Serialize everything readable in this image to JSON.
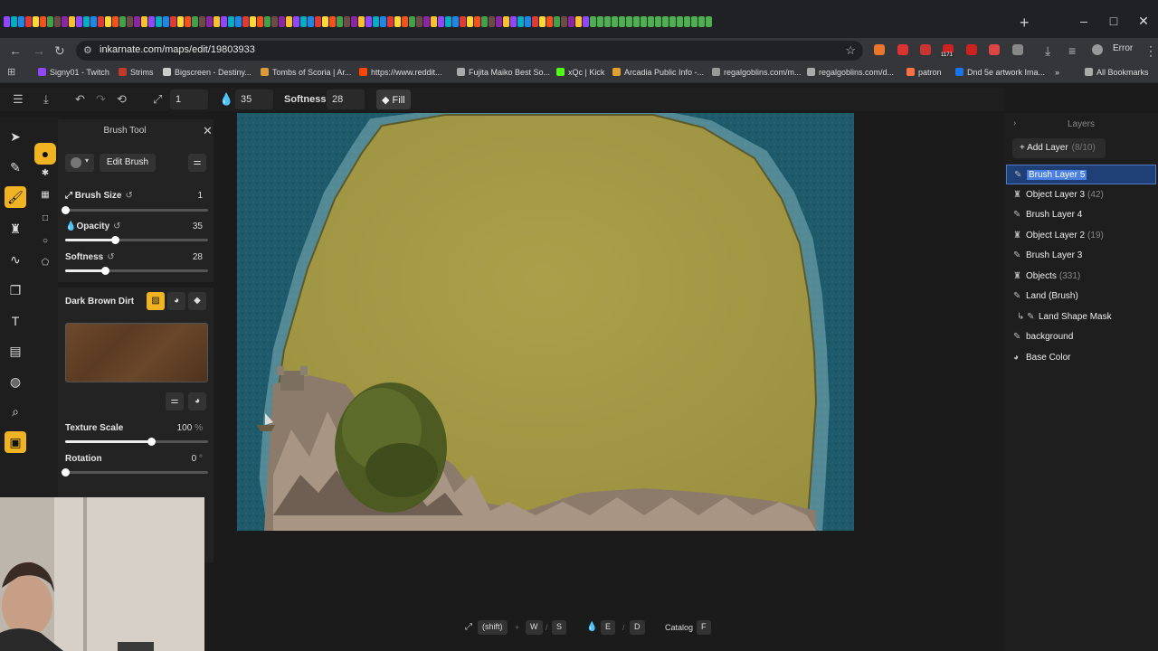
{
  "browser": {
    "url": "inkarnate.com/maps/edit/19803933",
    "error_label": "Error",
    "ext_badge": "1171",
    "bookmarks": [
      "Signy01 - Twitch",
      "Strims",
      "Bigscreen - Destiny...",
      "Tombs of Scoria | Ar...",
      "https://www.reddit...",
      "Fujita Maiko Best So...",
      "xQc | Kick",
      "Arcadia Public Info -...",
      "regalgoblins.com/m...",
      "regalgoblins.com/d...",
      "patron",
      "Dnd 5e artwork Ima..."
    ],
    "all_bookmarks": "All Bookmarks",
    "bookmark_colors": [
      "#9146ff",
      "#c0392b",
      "#cccccc",
      "#d99a3a",
      "#ff4500",
      "#aaaaaa",
      "#53fc18",
      "#e0a030",
      "#999999",
      "#aaaaaa",
      "#ff7043",
      "#1a73e8"
    ]
  },
  "toolbar": {
    "brush_size": "1",
    "opacity": "35",
    "softness_label": "Softness:",
    "softness": "28",
    "fill_label": "Fill"
  },
  "brush_panel": {
    "title": "Brush Tool",
    "edit_brush": "Edit Brush",
    "brush_size_label": "Brush Size",
    "brush_size_value": "1",
    "brush_size_fraction": 0.0,
    "opacity_label": "Opacity",
    "opacity_value": "35",
    "opacity_fraction": 0.35,
    "softness_label": "Softness",
    "softness_value": "28",
    "softness_fraction": 0.28,
    "texture_name": "Dark Brown Dirt",
    "texture_scale_label": "Texture Scale",
    "texture_scale_value": "100",
    "texture_scale_unit": "%",
    "texture_scale_fraction": 0.6,
    "rotation_label": "Rotation",
    "rotation_value": "0",
    "rotation_unit": "°",
    "rotation_fraction": 0.0
  },
  "layers": {
    "title": "Layers",
    "add_layer": "Add Layer",
    "add_layer_count": "(8/10)",
    "items": [
      {
        "name": "Brush Layer 5",
        "count": "",
        "icon": "brush-icon",
        "selected": true
      },
      {
        "name": "Object Layer 3",
        "count": "(42)",
        "icon": "tower-icon"
      },
      {
        "name": "Brush Layer 4",
        "count": "",
        "icon": "brush-icon"
      },
      {
        "name": "Object Layer 2",
        "count": "(19)",
        "icon": "tower-icon"
      },
      {
        "name": "Brush Layer 3",
        "count": "",
        "icon": "brush-icon"
      },
      {
        "name": "Objects",
        "count": "(331)",
        "icon": "tower-icon"
      },
      {
        "name": "Land (Brush)",
        "count": "",
        "icon": "brush-icon"
      },
      {
        "name": "Land Shape Mask",
        "count": "",
        "icon": "mask-icon",
        "indent": true
      },
      {
        "name": "background",
        "count": "",
        "icon": "brush-icon"
      },
      {
        "name": "Base Color",
        "count": "",
        "icon": "palette-icon"
      }
    ]
  },
  "shortcuts": {
    "shift": "(shift)",
    "w": "W",
    "s": "S",
    "e": "E",
    "d": "D",
    "catalog": "Catalog",
    "f": "F"
  },
  "colors": {
    "accent": "#f0b423",
    "selected_layer": "#1f3f77",
    "water": "#1f5a6b",
    "land": "#a59b45"
  }
}
